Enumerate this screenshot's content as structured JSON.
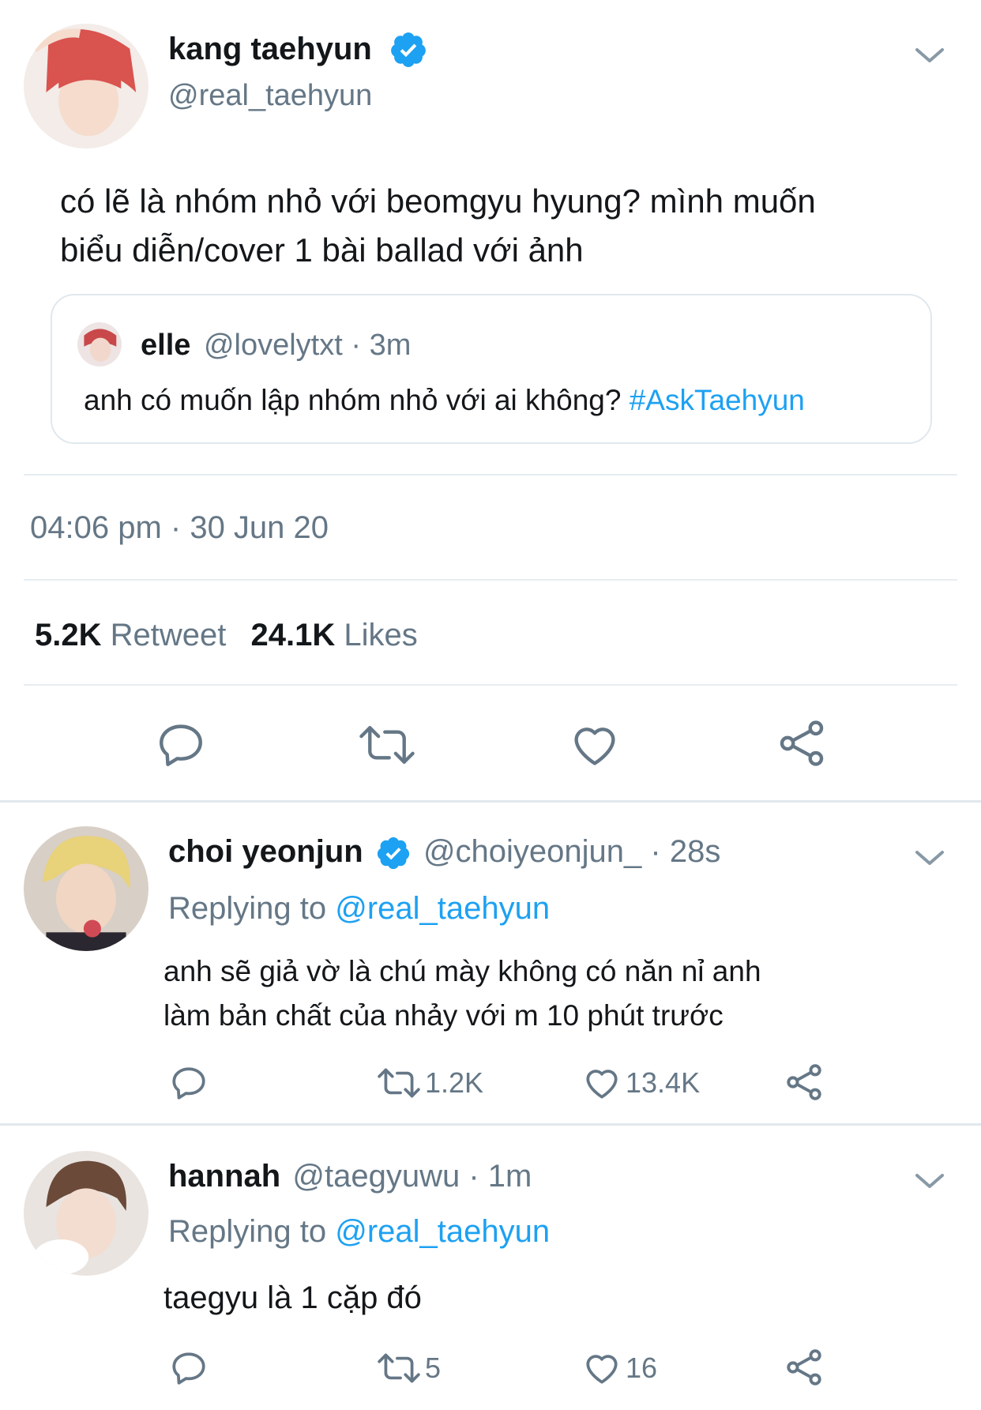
{
  "main_tweet": {
    "display_name": "kang taehyun",
    "handle": "@real_taehyun",
    "text_line1": "có lẽ là nhóm nhỏ với beomgyu hyung? mình muốn",
    "text_line2": "biểu diễn/cover 1 bài ballad với ảnh",
    "quoted": {
      "display_name": "elle",
      "handle": "@lovelytxt",
      "time": "· 3m",
      "text": "anh có muốn lập nhóm nhỏ với ai không?",
      "hashtag": "#AskTaehyun"
    },
    "timestamp": "04:06 pm · 30 Jun 20",
    "retweet_count": "5.2K",
    "retweet_label": "Retweet",
    "likes_count": "24.1K",
    "likes_label": "Likes"
  },
  "replies": [
    {
      "display_name": "choi yeonjun",
      "handle": "@choiyeonjun_",
      "time": "· 28s",
      "replying_prefix": "Replying to",
      "replying_to": "@real_taehyun",
      "text_line1": "anh sẽ giả vờ là chú mày không có năn nỉ anh",
      "text_line2": "làm bản chất của nhảy với m 10 phút trước",
      "retweets": "1.2K",
      "likes": "13.4K"
    },
    {
      "display_name": "hannah",
      "handle": "@taegyuwu",
      "time": "· 1m",
      "replying_prefix": "Replying to",
      "replying_to": "@real_taehyun",
      "text_line1": "taegyu là 1 cặp đó",
      "retweets": "5",
      "likes": "16"
    }
  ],
  "colors": {
    "accent": "#1da1f2",
    "secondary_text": "#657786",
    "divider": "#e6ecf0"
  },
  "icons": [
    "chevron-down-icon",
    "verified-badge-icon",
    "reply-icon",
    "retweet-icon",
    "like-icon",
    "share-icon"
  ]
}
